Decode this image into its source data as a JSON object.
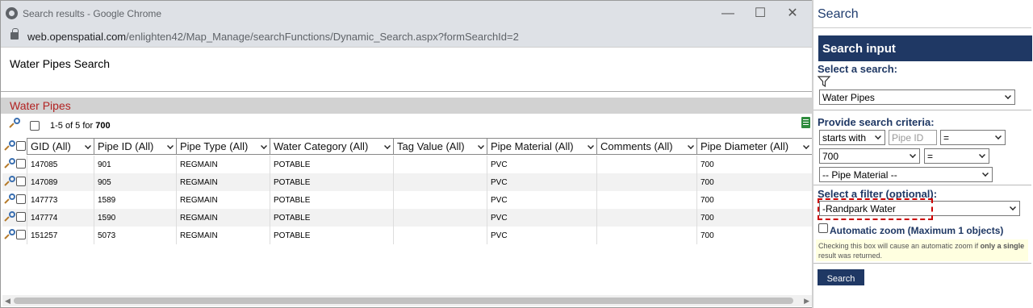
{
  "window": {
    "title": "Search results - Google Chrome",
    "url_host": "web.openspatial.com",
    "url_path": "/enlighten42/Map_Manage/searchFunctions/Dynamic_Search.aspx?formSearchId=2",
    "minimize": "—",
    "maximize": "☐",
    "close": "✕"
  },
  "page": {
    "title": "Water Pipes Search",
    "section": "Water Pipes",
    "count_text": "1-5 of 5 for",
    "count_term": "700"
  },
  "grid": {
    "columns": [
      "GID (All)",
      "Pipe ID (All)",
      "Pipe Type (All)",
      "Water Category (All)",
      "Tag Value (All)",
      "Pipe Material (All)",
      "Comments (All)",
      "Pipe Diameter (All)"
    ],
    "rows": [
      [
        "147085",
        "901",
        "REGMAIN",
        "POTABLE",
        "",
        "PVC",
        "",
        "700"
      ],
      [
        "147089",
        "905",
        "REGMAIN",
        "POTABLE",
        "",
        "PVC",
        "",
        "700"
      ],
      [
        "147773",
        "1589",
        "REGMAIN",
        "POTABLE",
        "",
        "PVC",
        "",
        "700"
      ],
      [
        "147774",
        "1590",
        "REGMAIN",
        "POTABLE",
        "",
        "PVC",
        "",
        "700"
      ],
      [
        "151257",
        "5073",
        "REGMAIN",
        "POTABLE",
        "",
        "PVC",
        "",
        "700"
      ]
    ]
  },
  "panel": {
    "title": "Search",
    "input_header": "Search input",
    "select_search_label": "Select a search:",
    "search_value": "Water Pipes",
    "criteria_label": "Provide search criteria:",
    "operator": "starts with",
    "pipe_id_placeholder": "Pipe ID",
    "eq1": "=",
    "diameter_value": "700",
    "eq2": "=",
    "material_value": "-- Pipe Material --",
    "filter_label": "Select a filter (optional):",
    "filter_value": "-Randpark Water",
    "auto_zoom_label": "Automatic zoom (Maximum 1 objects)",
    "note_before": "Checking this box will cause an automatic zoom if",
    "note_bold": "only a single",
    "note_after": "result was returned.",
    "search_button": "Search"
  },
  "colors": {
    "header_navy": "#1f3864",
    "section_red": "#b22222",
    "filter_highlight": "#cc0000",
    "note_bg": "#ffffe0"
  }
}
